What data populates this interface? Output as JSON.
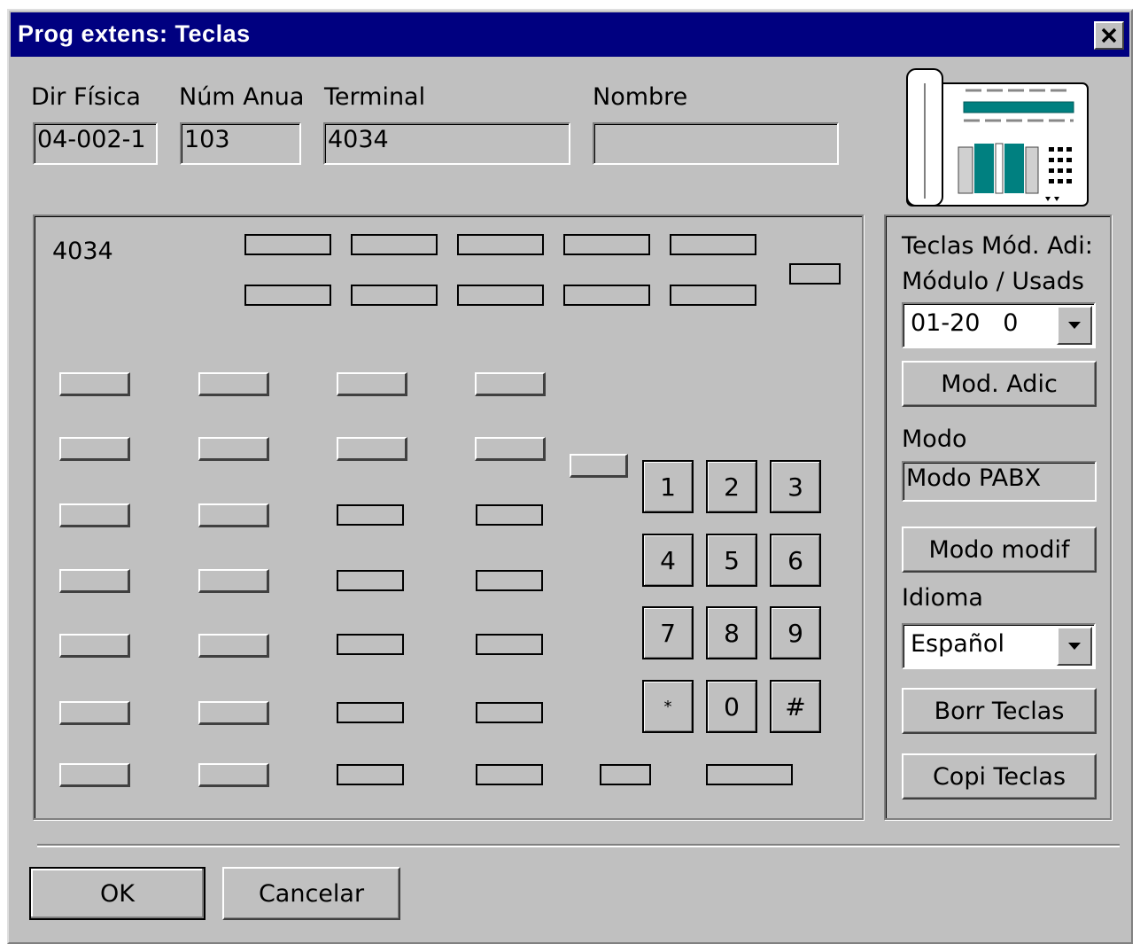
{
  "window": {
    "title": "Prog extens: Teclas"
  },
  "fields": {
    "dir_fisica": {
      "label": "Dir Física",
      "value": "04-002-1"
    },
    "num_anua": {
      "label": "Núm Anua",
      "value": "103"
    },
    "terminal": {
      "label": "Terminal",
      "value": "4034"
    },
    "nombre": {
      "label": "Nombre",
      "value": ""
    }
  },
  "keypad_panel": {
    "terminal_label": "4034",
    "dial_keys": [
      "1",
      "2",
      "3",
      "4",
      "5",
      "6",
      "7",
      "8",
      "9",
      "*",
      "0",
      "#"
    ]
  },
  "side_panel": {
    "teclas_mod_label": "Teclas Mód. Adi:",
    "modulo_usads_label": "Módulo / Usads",
    "modulo_select_value": "01-20   0",
    "mod_adic_button": "Mod. Adic",
    "modo_label": "Modo",
    "modo_value": "Modo PABX",
    "modo_modif_button": "Modo modif",
    "idioma_label": "Idioma",
    "idioma_select_value": "Español",
    "borr_teclas_button": "Borr Teclas",
    "copi_teclas_button": "Copi Teclas"
  },
  "footer": {
    "ok_button": "OK",
    "cancel_button": "Cancelar"
  },
  "icons": {
    "close": "close-icon",
    "phone": "phone-illustration",
    "dropdown": "dropdown-arrow-icon"
  },
  "colors": {
    "title_bar": "#000080",
    "face": "#c0c0c0"
  }
}
